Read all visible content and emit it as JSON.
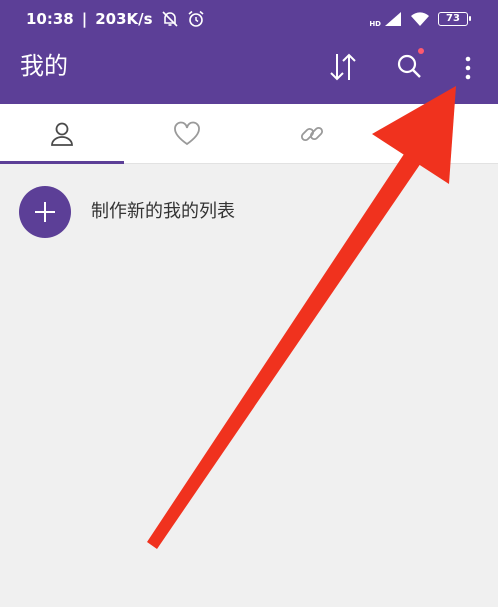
{
  "status_bar": {
    "time": "10:38",
    "net_speed": "203K/s",
    "network_label": "HD",
    "battery": "73",
    "icons": [
      "notifications-off-icon",
      "alarm-icon",
      "signal-icon",
      "wifi-icon",
      "battery-icon"
    ]
  },
  "toolbar": {
    "title": "我的",
    "actions": [
      "sort-icon",
      "search-icon",
      "more-vert-icon"
    ],
    "notification_dot_color": "#ff5a6e"
  },
  "tabs": [
    {
      "icon": "person-icon",
      "selected": true
    },
    {
      "icon": "heart-icon",
      "selected": false
    },
    {
      "icon": "link-icon",
      "selected": false
    }
  ],
  "create_list": {
    "label": "制作新的我的列表",
    "icon": "plus-icon"
  },
  "colors": {
    "primary": "#5c3f97",
    "background": "#f0f0f0",
    "annotation_arrow": "#f0321e"
  }
}
